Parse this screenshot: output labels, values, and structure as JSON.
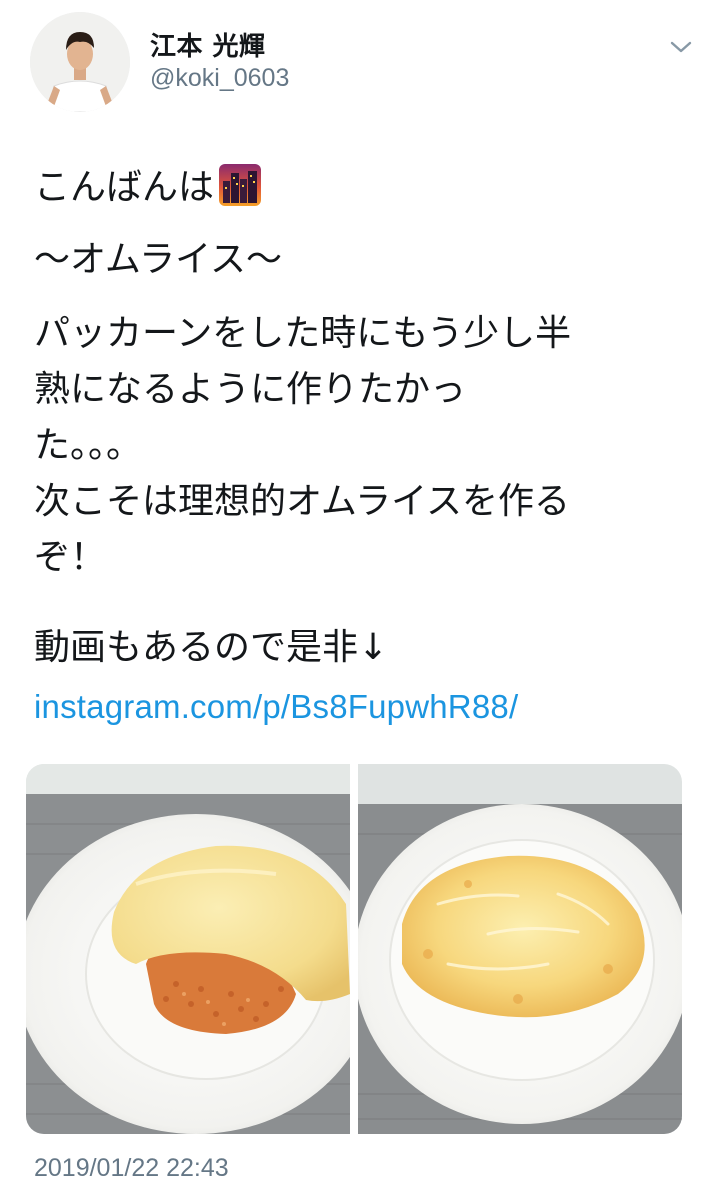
{
  "user": {
    "display_name": "江本 光輝",
    "handle": "@koki_0603"
  },
  "tweet": {
    "line1": "こんばんは",
    "line1_emoji": "city-sunset-emoji",
    "line2": "〜オムライス〜",
    "paragraph": "パッカーンをした時にもう少し半\n熟になるように作りたかっ\nた。。。\n次こそは理想的オムライスを作る\nぞ！",
    "line_last": "動画もあるので是非↓",
    "link": "instagram.com/p/Bs8FupwhR88/",
    "timestamp": "2019/01/22 22:43"
  },
  "media": {
    "photos": [
      {
        "subject": "omurice-with-rice-visible"
      },
      {
        "subject": "omurice-opened-egg"
      }
    ]
  },
  "colors": {
    "text": "#14171a",
    "secondary": "#657786",
    "link": "#1b95e0"
  }
}
